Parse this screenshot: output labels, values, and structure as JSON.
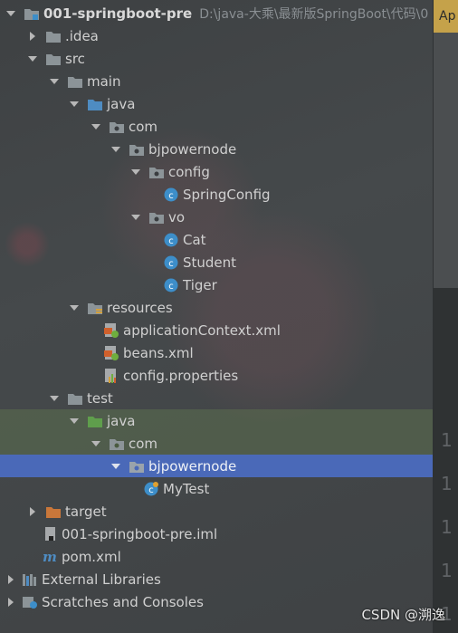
{
  "project": {
    "name": "001-springboot-pre",
    "path": "D:\\java-大乘\\最新版SpringBoot\\代码\\0"
  },
  "tree": {
    "idea": ".idea",
    "src": "src",
    "main": "main",
    "java_main": "java",
    "com_main": "com",
    "bjpowernode_main": "bjpowernode",
    "config": "config",
    "SpringConfig": "SpringConfig",
    "vo": "vo",
    "Cat": "Cat",
    "Student": "Student",
    "Tiger": "Tiger",
    "resources": "resources",
    "applicationContext": "applicationContext.xml",
    "beans": "beans.xml",
    "configProperties": "config.properties",
    "test": "test",
    "java_test": "java",
    "com_test": "com",
    "bjpowernode_test": "bjpowernode",
    "MyTest": "MyTest",
    "target": "target",
    "iml": "001-springboot-pre.iml",
    "pom": "pom.xml",
    "externalLibraries": "External Libraries",
    "scratches": "Scratches and Consoles"
  },
  "editor": {
    "tab_label": "Ap",
    "line_numbers": [
      "1",
      "1",
      "1",
      "1",
      "1"
    ]
  },
  "watermark": "CSDN @溯逸",
  "colors": {
    "folder": "#8c9498",
    "source_folder": "#4e8cc2",
    "test_folder": "#5f9e4c",
    "target_folder": "#c9773a",
    "class_icon": "#3d8ec9",
    "selection": "#4a69b8"
  }
}
